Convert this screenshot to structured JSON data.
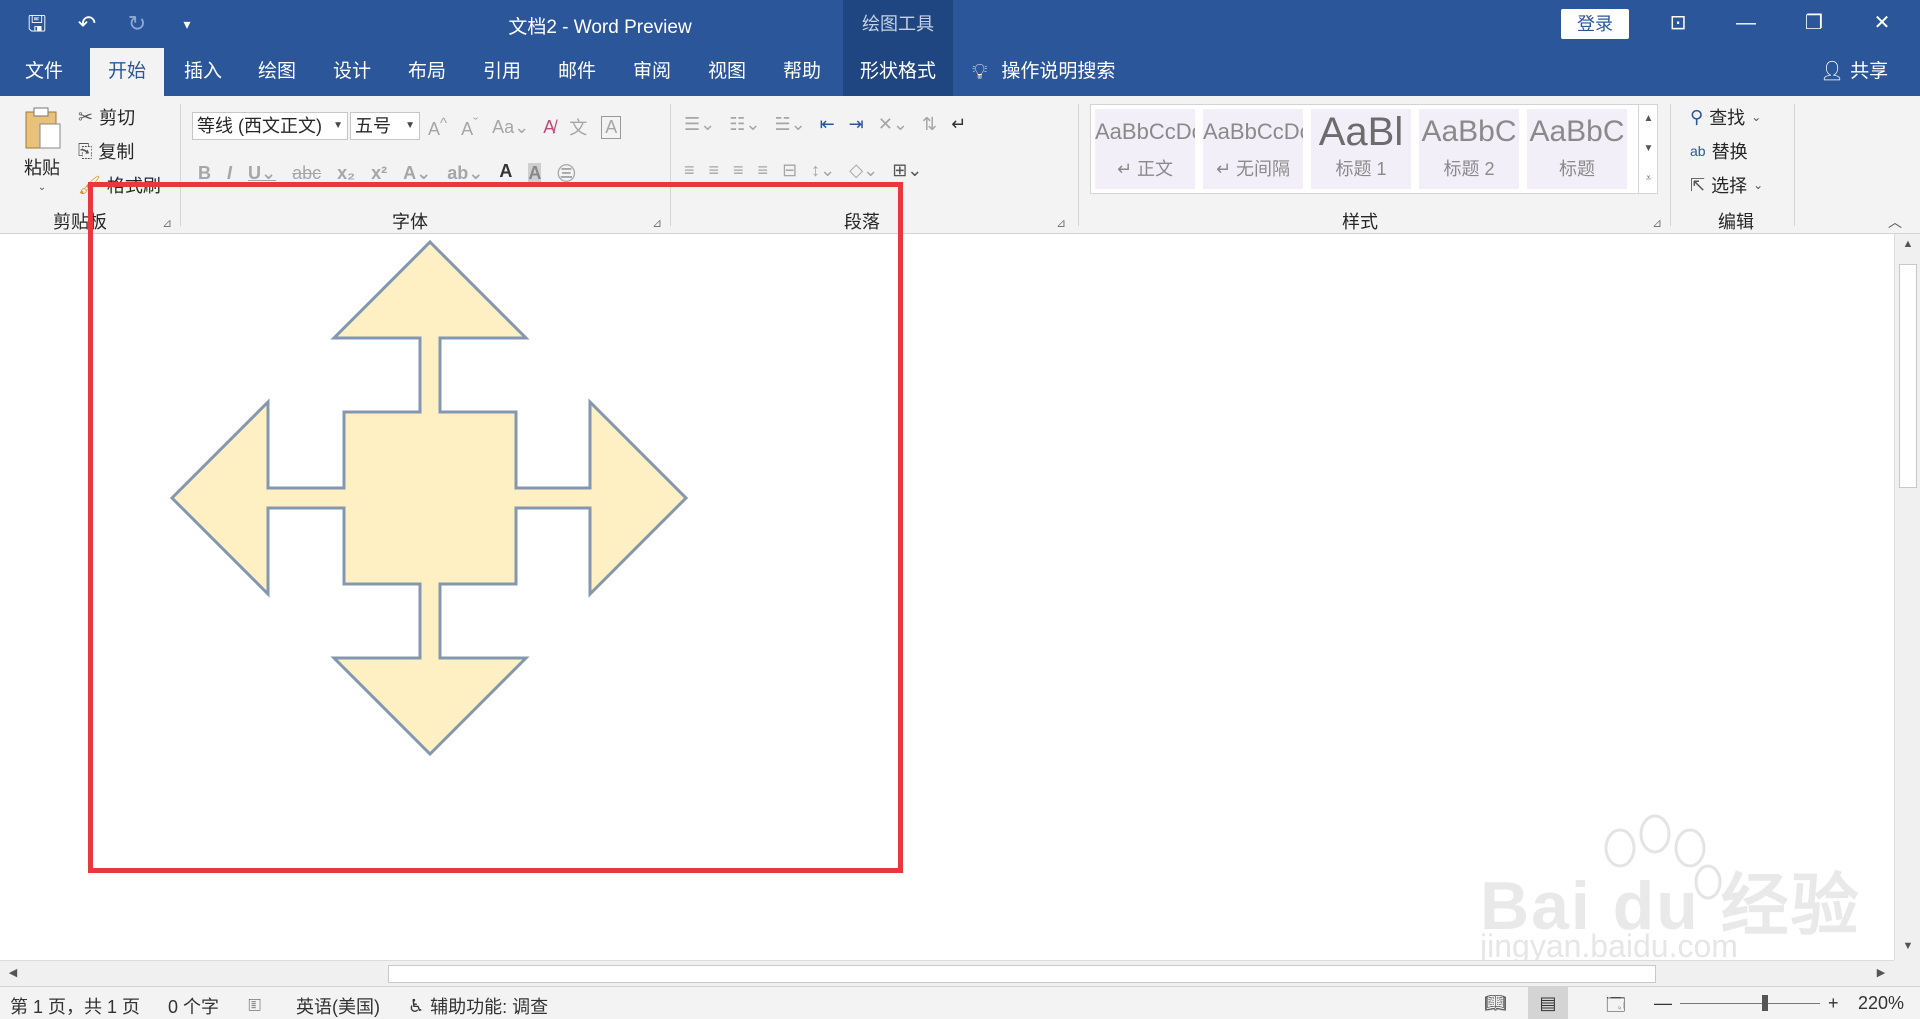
{
  "title_bar": {
    "title": "文档2  -  Word Preview",
    "context_tools": "绘图工具",
    "login": "登录"
  },
  "tabs": [
    "文件",
    "开始",
    "插入",
    "绘图",
    "设计",
    "布局",
    "引用",
    "邮件",
    "审阅",
    "视图",
    "帮助",
    "形状格式"
  ],
  "active_tab": "开始",
  "tell_me": "操作说明搜索",
  "share": "共享",
  "clipboard": {
    "paste": "粘贴",
    "cut": "剪切",
    "copy": "复制",
    "format_painter": "格式刷",
    "label": "剪贴板"
  },
  "font": {
    "name": "等线 (西文正文)",
    "size": "五号",
    "label": "字体"
  },
  "paragraph": {
    "label": "段落"
  },
  "styles": {
    "label": "样式",
    "items": [
      {
        "sample": "AaBbCcDc",
        "name": "↵ 正文"
      },
      {
        "sample": "AaBbCcDc",
        "name": "↵ 无间隔"
      },
      {
        "sample": "AaBl",
        "name": "标题 1"
      },
      {
        "sample": "AaBbC",
        "name": "标题 2"
      },
      {
        "sample": "AaBbC",
        "name": "标题"
      }
    ]
  },
  "editing": {
    "find": "查找",
    "replace": "替换",
    "select": "选择",
    "label": "编辑"
  },
  "shape": {
    "type": "four-way-arrow",
    "fill": "#fff0c3",
    "stroke": "#8497b0"
  },
  "highlight_color": "#e8383d",
  "watermark": {
    "main": "Bai du 经验",
    "sub": "jingyan.baidu.com"
  },
  "status": {
    "page": "第 1 页，共 1 页",
    "words": "0 个字",
    "language": "英语(美国)",
    "accessibility": "辅助功能: 调查",
    "zoom": "220%"
  }
}
